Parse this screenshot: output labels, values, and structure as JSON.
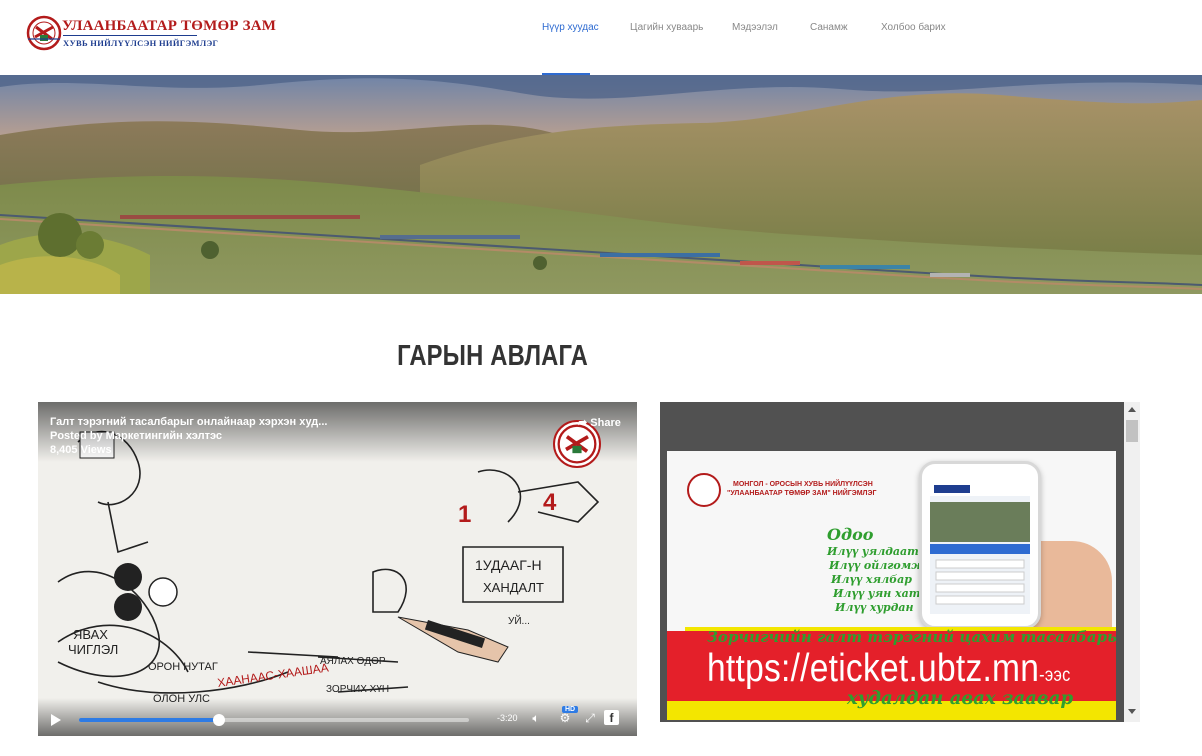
{
  "brand": {
    "title": "УЛААНБААТАР ТӨМӨР ЗАМ",
    "subtitle": "ХУВЬ НИЙЛҮҮЛСЭН НИЙГЭМЛЭГ"
  },
  "nav": {
    "items": [
      {
        "label": "Нүүр хуудас",
        "active": true
      },
      {
        "label": "Цагийн хуваарь",
        "active": false
      },
      {
        "label": "Мэдээлэл",
        "active": false
      },
      {
        "label": "Санамж",
        "active": false
      },
      {
        "label": "Холбоо барих",
        "active": false
      }
    ]
  },
  "section": {
    "title": "ГАРЫН АВЛАГА"
  },
  "video": {
    "title": "Галт тэрэгний тасалбарыг онлайнаар хэрхэн худ...",
    "posted_by": "Posted by Маркетингийн хэлтэс",
    "views": "8,405 Views",
    "share_label": "Share",
    "time_remaining": "-3:20",
    "hd_label": "HD",
    "progress": 0.36,
    "board_texts": {
      "t1": "1",
      "t2": "4",
      "t3": "1УДААГ-Н",
      "t4": "ХАНДАЛТ",
      "t5": "ЯВАХ",
      "t6": "ЧИГЛЭЛ",
      "t7": "ОРОН НУТАГ",
      "t8": "ХААНААС-ХААШАА",
      "t9": "АЯЛАХ ӨДӨР",
      "t10": "ОЛОН УЛС",
      "t11": "ЗОРЧИХ ХҮН",
      "t12": "УЙ..."
    },
    "icons": [
      "play-icon",
      "volume-icon",
      "settings-icon",
      "fullscreen-icon",
      "facebook-icon",
      "share-icon"
    ]
  },
  "poster": {
    "org_line1": "МОНГОЛ - ОРОСЫН ХУВЬ НИЙЛҮҮЛСЭН",
    "org_line2": "\"УЛААНБААТАР ТӨМӨР ЗАМ\" НИЙГЭМЛЭГ",
    "odoo": "Одоо",
    "benefits": [
      "Илүү уялдаатай",
      "Илүү ойлгомжтой",
      "Илүү хялбар",
      "Илүү уян хатан",
      "Илүү хурдан"
    ],
    "headline": "Зорчигчийн галт тэрэгний цахим тасалбарыг",
    "url": "https://eticket.ubtz.mn",
    "url_suffix": "-ээс",
    "footer": "худалдан авах заавар"
  },
  "colors": {
    "accent": "#2e6bd1",
    "brand_red": "#b31b1b",
    "poster_red": "#e4202a",
    "poster_yellow": "#f3e600",
    "poster_green": "#2f9e2f"
  }
}
